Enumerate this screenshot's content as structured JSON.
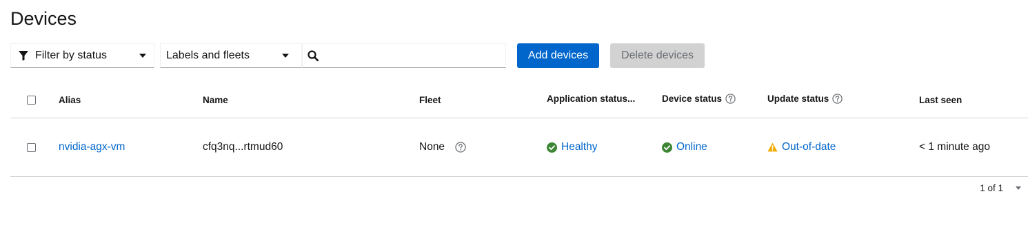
{
  "page": {
    "title": "Devices"
  },
  "toolbar": {
    "filter_status_label": "Filter by status",
    "labels_fleets_label": "Labels and fleets",
    "search_placeholder": "",
    "add_devices_label": "Add devices",
    "delete_devices_label": "Delete devices"
  },
  "table": {
    "columns": {
      "alias": "Alias",
      "name": "Name",
      "fleet": "Fleet",
      "application_status": "Application status...",
      "device_status": "Device status",
      "update_status": "Update status",
      "last_seen": "Last seen"
    },
    "rows": [
      {
        "alias": "nvidia-agx-vm",
        "name": "cfq3nq...rtmud60",
        "fleet": "None",
        "application_status": "Healthy",
        "device_status": "Online",
        "update_status": "Out-of-date",
        "last_seen": "< 1 minute ago"
      }
    ]
  },
  "pagination": {
    "range": "1 of 1"
  },
  "colors": {
    "primary": "#0066cc",
    "success": "#3e8635",
    "warning": "#f0ab00",
    "disabled_bg": "#d2d2d2",
    "border": "#d2d2d2"
  },
  "icons": {
    "filter": "funnel-icon",
    "dropdown": "caret-down-icon",
    "search": "search-icon",
    "help": "question-circle-icon",
    "healthy": "check-circle-icon",
    "online": "check-circle-icon",
    "out_of_date": "warning-triangle-icon"
  }
}
